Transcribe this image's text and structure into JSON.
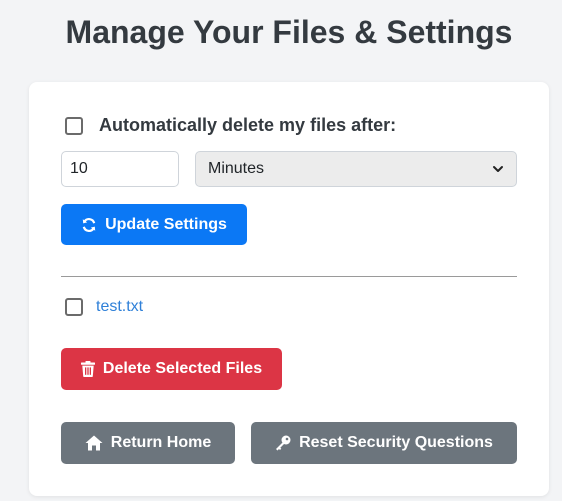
{
  "page": {
    "title": "Manage Your Files & Settings"
  },
  "settings": {
    "auto_delete_label": "Automatically delete my files after:",
    "auto_delete_checked": false,
    "duration_value": "10",
    "unit_selected": "Minutes",
    "update_button_label": "Update Settings",
    "update_icon": "refresh-icon"
  },
  "files": {
    "items": [
      {
        "name": "test.txt",
        "checked": false
      }
    ],
    "delete_button_label": "Delete Selected Files",
    "delete_icon": "trash-icon"
  },
  "footer": {
    "home_button_label": "Return Home",
    "home_icon": "home-icon",
    "reset_button_label": "Reset Security Questions",
    "reset_icon": "key-icon"
  },
  "colors": {
    "primary": "#0b78f5",
    "danger": "#dc3545",
    "secondary": "#6c757d",
    "link": "#2f80d8"
  }
}
